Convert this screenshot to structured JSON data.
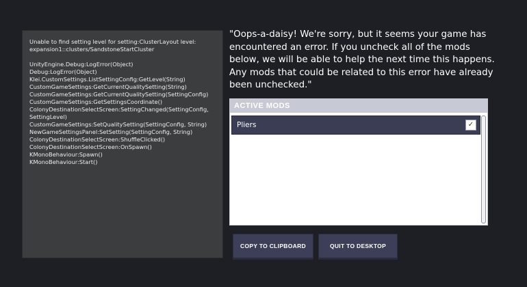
{
  "error_log": {
    "header_lines": [
      "Unable to find setting level for setting:ClusterLayout level:",
      "expansion1::clusters/SandstoneStartCluster"
    ],
    "stack_lines": [
      "UnityEngine.Debug:LogError(Object)",
      "Debug:LogError(Object)",
      "Klei.CustomSettings.ListSettingConfig:GetLevel(String)",
      "CustomGameSettings:GetCurrentQualitySetting(String)",
      "CustomGameSettings:GetCurrentQualitySetting(SettingConfig)",
      "CustomGameSettings:GetSettingsCoordinate()",
      "ColonyDestinationSelectScreen:SettingChanged(SettingConfig,",
      "SettingLevel)",
      "CustomGameSettings:SetQualitySetting(SettingConfig, String)",
      "NewGameSettingsPanel:SetSetting(SettingConfig, String)",
      "ColonyDestinationSelectScreen:ShuffleClicked()",
      "ColonyDestinationSelectScreen:OnSpawn()",
      "KMonoBehaviour:Spawn()",
      "KMonoBehaviour:Start()"
    ]
  },
  "message": "\"Oops-a-daisy! We're sorry, but it seems your game has encountered an error. If you uncheck all of the mods below, we will be able to help the next time this happens. Any mods that could be related to this error have already been unchecked.\"",
  "mods_panel": {
    "header": "ACTIVE MODS",
    "mods": [
      {
        "name": "Pliers",
        "checked": true,
        "check_glyph": "✓"
      }
    ]
  },
  "buttons": {
    "copy": "COPY TO CLIPBOARD",
    "quit": "QUIT TO DESKTOP"
  }
}
